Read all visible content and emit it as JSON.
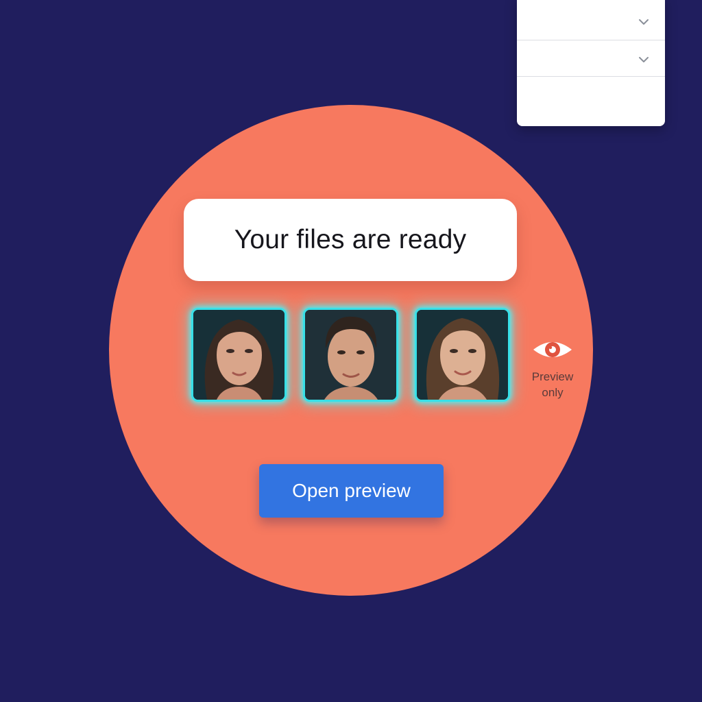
{
  "colors": {
    "background": "#201e5e",
    "accent_circle": "#f7795f",
    "thumbnail_glow": "#38e0e8",
    "button": "#3274e1",
    "eye_icon": "#e0533f"
  },
  "dropdown": {
    "rows": [
      {
        "icon": "chevron-down-icon"
      },
      {
        "icon": "chevron-down-icon"
      }
    ]
  },
  "card": {
    "title": "Your files are ready"
  },
  "thumbnails": [
    {
      "icon": "portrait-photo"
    },
    {
      "icon": "portrait-photo"
    },
    {
      "icon": "portrait-photo"
    }
  ],
  "preview_note": {
    "icon": "eye-icon",
    "line1": "Preview",
    "line2": "only"
  },
  "actions": {
    "open_preview_label": "Open preview"
  }
}
